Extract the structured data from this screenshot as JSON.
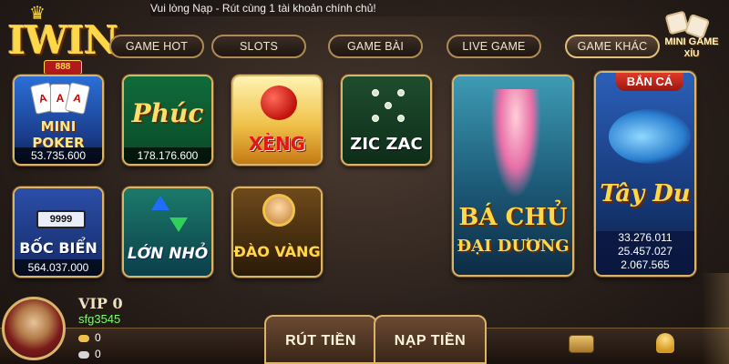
{
  "marquee": {
    "text": "Vui lòng Nạp - Rút cùng 1 tài khoản chính chủ!"
  },
  "logo": {
    "text": "IWIN",
    "sub": "888"
  },
  "nav": {
    "tabs": [
      {
        "label": "GAME HOT"
      },
      {
        "label": "SLOTS"
      },
      {
        "label": "GAME BÀI"
      },
      {
        "label": "LIVE GAME"
      },
      {
        "label": "GAME KHÁC"
      }
    ],
    "active_index": 4
  },
  "mini_game": {
    "label": "MINI GAME",
    "sub": "XỈU"
  },
  "games": {
    "mini_poker": {
      "title_top": "AAA",
      "title": "MINI POKER",
      "value": "53.735.600"
    },
    "slots_phuc": {
      "title": "Phúc",
      "value": "178.176.600"
    },
    "xeng": {
      "title": "XÈNG"
    },
    "zic_zac": {
      "title": "ZIC ZAC"
    },
    "boc_bien": {
      "plate": "9999",
      "title": "BỐC BIỂN",
      "value": "564.037.000"
    },
    "lon_nho": {
      "title": "LỚN NHỎ"
    },
    "dao_vang": {
      "title": "ĐÀO VÀNG"
    },
    "ba_chu": {
      "title": "BÁ CHỦ",
      "subtitle": "ĐẠI DƯƠNG"
    },
    "tay_du": {
      "ribbon": "BẮN CÁ",
      "title": "Tây Du",
      "values": [
        "33.276.011",
        "25.457.027",
        "2.067.565"
      ]
    }
  },
  "user": {
    "vip": "VIP 0",
    "username": "sfg3545",
    "gold": "0",
    "silver": "0"
  },
  "actions": {
    "withdraw": "RÚT TIỀN",
    "deposit": "NẠP TIỀN"
  },
  "colors": {
    "accent": "#d9b46a",
    "background": "#2b211c",
    "username": "#7dff6a"
  }
}
